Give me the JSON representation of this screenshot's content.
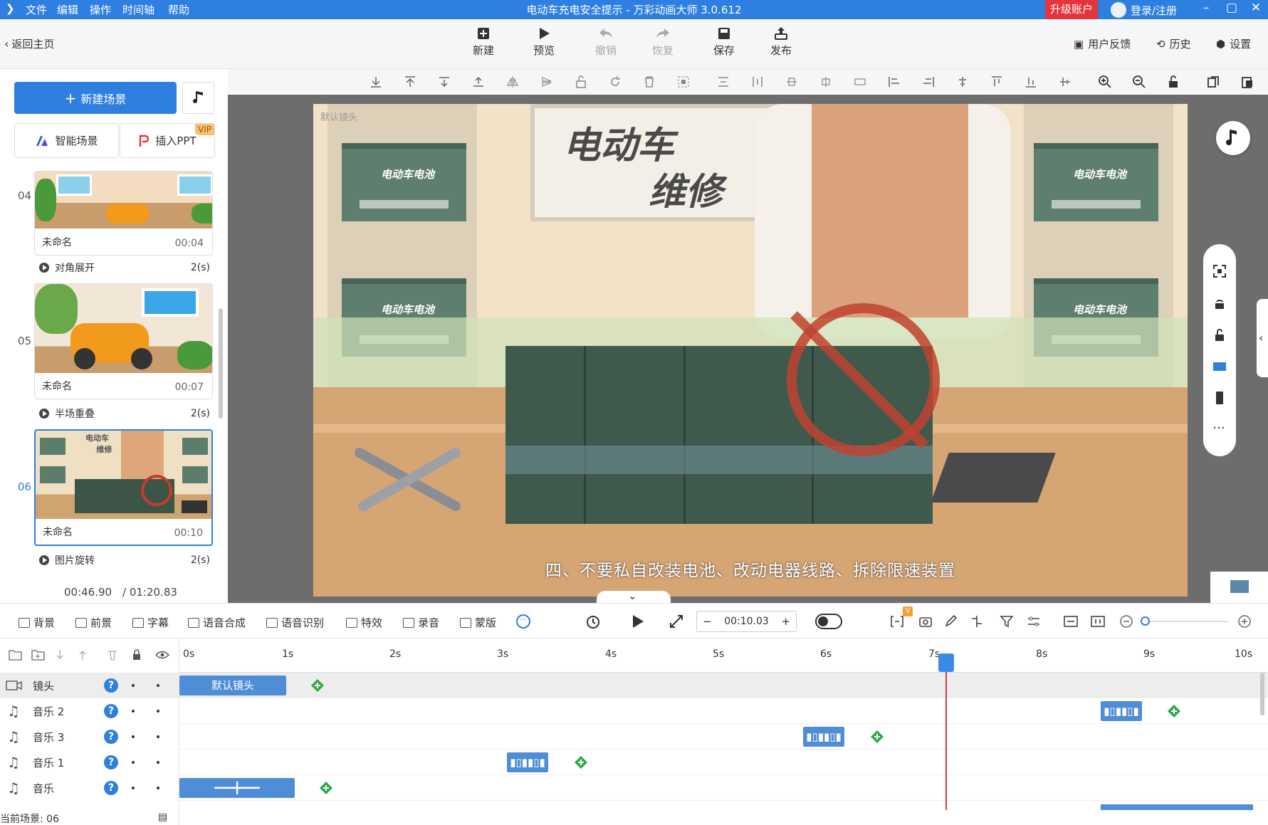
{
  "titlebar": {
    "menus": [
      "文件",
      "编辑",
      "操作",
      "时间轴",
      "帮助"
    ],
    "title": "电动车充电安全提示 - 万彩动画大师 3.0.612",
    "upgrade": "升级账户",
    "login": "登录/注册"
  },
  "toolbar": {
    "back": "返回主页",
    "new": "新建",
    "preview": "预览",
    "undo": "撤销",
    "redo": "恢复",
    "save": "保存",
    "publish": "发布",
    "feedback": "用户反馈",
    "history": "历史",
    "settings": "设置"
  },
  "left": {
    "new_scene": "新建场景",
    "smart_scene": "智能场景",
    "insert_ppt": "插入PPT",
    "vip": "VIP",
    "scenes": [
      {
        "num": "04",
        "name": "未命名",
        "time": "00:04",
        "transition": "对角展开",
        "trans_dur": "2(s)"
      },
      {
        "num": "05",
        "name": "未命名",
        "time": "00:07",
        "transition": "半场重叠",
        "trans_dur": "2(s)"
      },
      {
        "num": "06",
        "name": "未命名",
        "time": "00:10",
        "transition": "图片旋转",
        "trans_dur": "2(s)"
      }
    ],
    "time_current": "00:46.90",
    "time_total": "/ 01:20.83"
  },
  "canvas": {
    "camera_label": "默认镜头",
    "subtitle": "四、不要私自改装电池、改动电器线路、拆除限速装置",
    "sign_line1": "电动车",
    "sign_line2": "维修",
    "battery_label": "电动车电池"
  },
  "bottom_toolbar": {
    "background": "背景",
    "foreground": "前景",
    "caption": "字幕",
    "tts": "语音合成",
    "asr": "语音识别",
    "effects": "特效",
    "record": "录音",
    "mask": "蒙版",
    "time": "00:10.03",
    "v_badge": "V"
  },
  "timeline": {
    "ticks": [
      "0s",
      "1s",
      "2s",
      "3s",
      "4s",
      "5s",
      "6s",
      "7s",
      "8s",
      "9s",
      "10s"
    ],
    "tracks": [
      {
        "name": "镜头",
        "clip": "默认镜头"
      },
      {
        "name": "音乐 2"
      },
      {
        "name": "音乐 3"
      },
      {
        "name": "音乐 1"
      },
      {
        "name": "音乐"
      }
    ],
    "status": "当前场景: 06"
  },
  "colors": {
    "accent": "#2f7fe0",
    "danger": "#e6353a",
    "clip": "#4f8ed6"
  }
}
